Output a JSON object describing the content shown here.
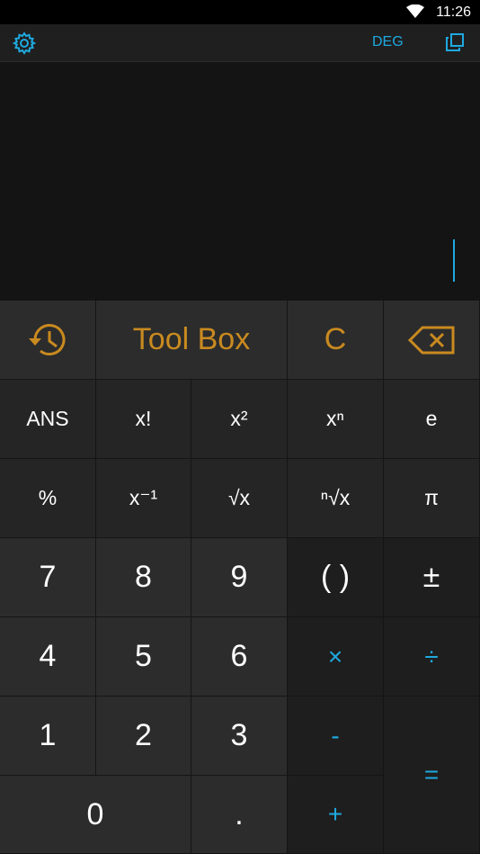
{
  "status_bar": {
    "time": "11:26"
  },
  "toolbar": {
    "angle_mode": "DEG"
  },
  "icons": {
    "settings": "gear-icon",
    "copy": "copy-icon",
    "history": "history-icon",
    "backspace": "backspace-icon",
    "wifi": "wifi-icon"
  },
  "keypad": {
    "toolbox": "Tool Box",
    "clear": "C",
    "row1": [
      "ANS",
      "x!",
      "x²",
      "xⁿ",
      "e"
    ],
    "row2": [
      "%",
      "x⁻¹",
      "√x",
      "ⁿ√x",
      "π"
    ],
    "row3": [
      "7",
      "8",
      "9",
      "( )",
      "±"
    ],
    "row4": [
      "4",
      "5",
      "6",
      "×",
      "÷"
    ],
    "row5": [
      "1",
      "2",
      "3",
      "-"
    ],
    "row6": [
      "0",
      ".",
      "+"
    ],
    "equals": "="
  },
  "colors": {
    "accent_blue": "#1fa9e0",
    "accent_orange": "#c98a1f",
    "background": "#1e1e1e"
  }
}
